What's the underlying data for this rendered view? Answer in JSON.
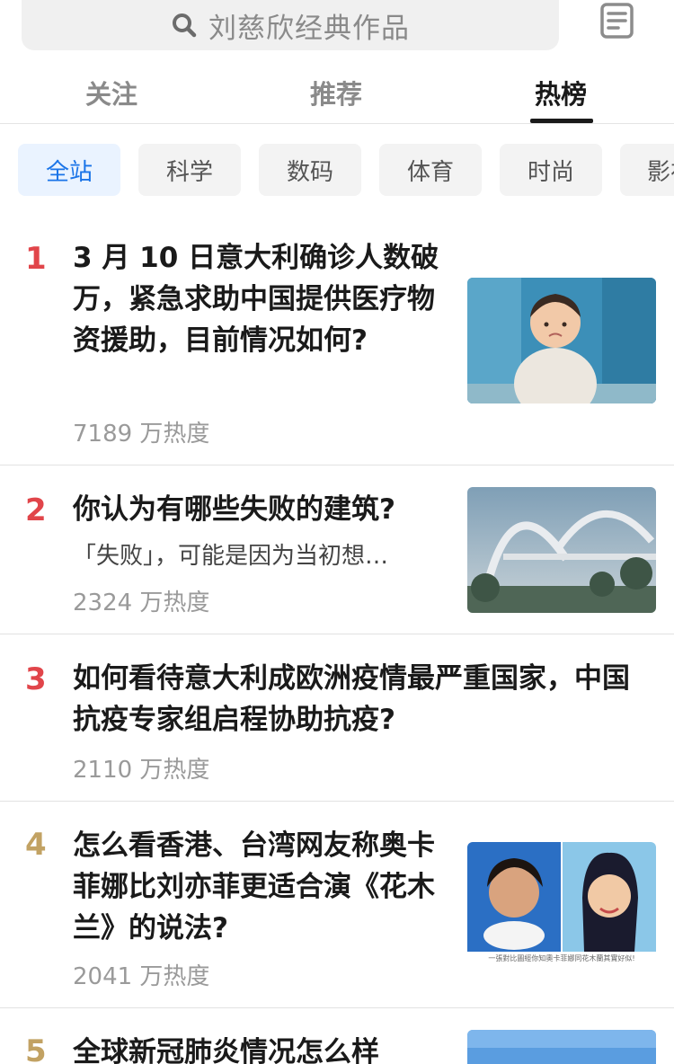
{
  "search": {
    "placeholder": "刘慈欣经典作品"
  },
  "tabs": [
    {
      "label": "关注"
    },
    {
      "label": "推荐"
    },
    {
      "label": "热榜"
    }
  ],
  "categories": [
    {
      "label": "全站"
    },
    {
      "label": "科学"
    },
    {
      "label": "数码"
    },
    {
      "label": "体育"
    },
    {
      "label": "时尚"
    },
    {
      "label": "影视"
    }
  ],
  "colors": {
    "accent": "#1a74e8",
    "rank_hot": "#e1454a",
    "rank_normal": "#c2a263"
  },
  "hotlist": [
    {
      "rank": "1",
      "title": "3 月 10 日意大利确诊人数破万，紧急求助中国提供医疗物资援助，目前情况如何?",
      "excerpt": "",
      "heat": "7189 万热度",
      "thumb_icon": "child-photo-thumbnail"
    },
    {
      "rank": "2",
      "title": "你认为有哪些失败的建筑?",
      "excerpt": "「失败」，可能是因为当初想…",
      "heat": "2324 万热度",
      "thumb_icon": "bridge-photo-thumbnail"
    },
    {
      "rank": "3",
      "title": "如何看待意大利成欧洲疫情最严重国家，中国抗疫专家组启程协助抗疫?",
      "excerpt": "",
      "heat": "2110 万热度",
      "thumb_icon": ""
    },
    {
      "rank": "4",
      "title": "怎么看香港、台湾网友称奥卡菲娜比刘亦菲更适合演《花木兰》的说法?",
      "excerpt": "",
      "heat": "2041 万热度",
      "thumb_icon": "mulan-comparison-thumbnail",
      "thumb_caption": "一張對比圖經你知奧卡菲娜同花木蘭其實好似!"
    },
    {
      "rank": "5",
      "title": "全球新冠肺炎情况怎么样",
      "excerpt": "",
      "heat": "",
      "thumb_icon": "photo-thumbnail"
    }
  ]
}
